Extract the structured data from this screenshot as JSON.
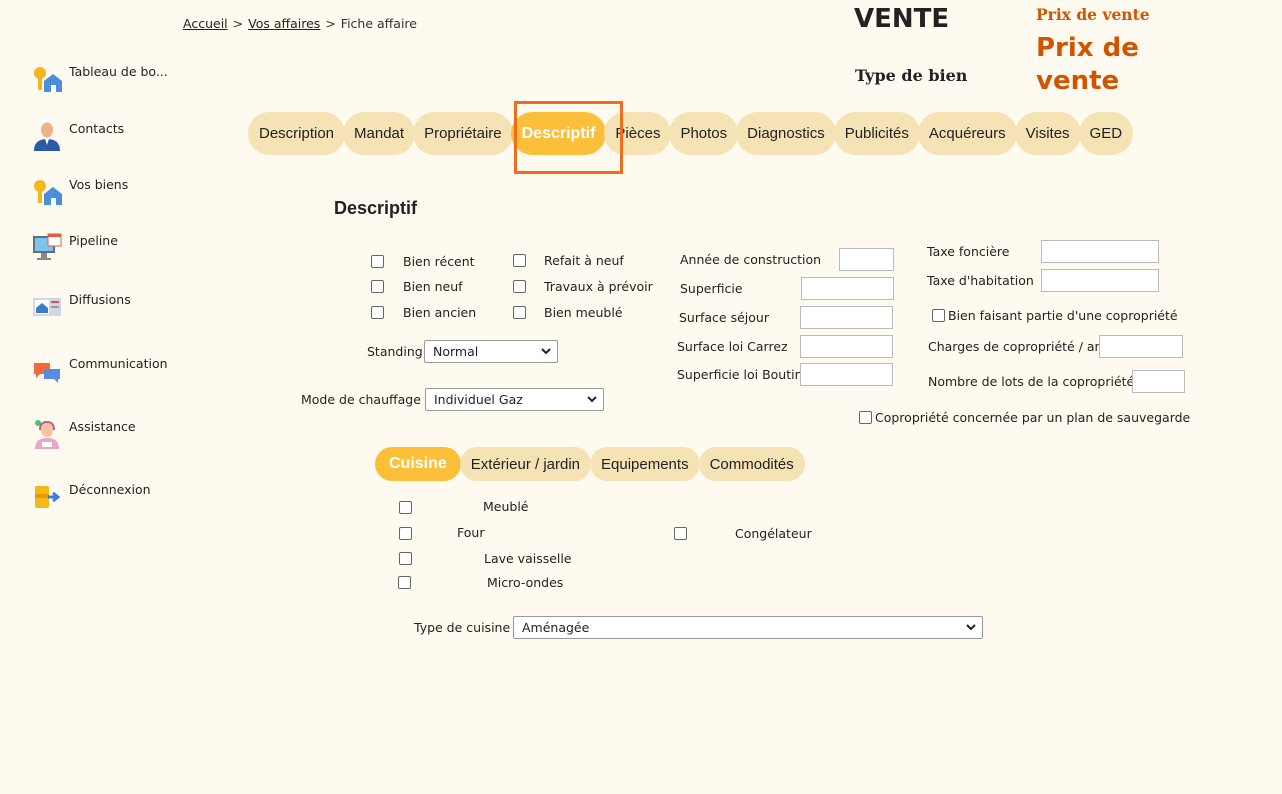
{
  "sidebar": {
    "items": [
      {
        "label": "Tableau de bo..."
      },
      {
        "label": "Contacts"
      },
      {
        "label": "Vos biens"
      },
      {
        "label": "Pipeline"
      },
      {
        "label": "Diffusions"
      },
      {
        "label": "Communication"
      },
      {
        "label": "Assistance"
      },
      {
        "label": "Déconnexion"
      }
    ]
  },
  "breadcrumb": {
    "home": "Accueil",
    "sep": ">",
    "affaires": "Vos affaires",
    "current": "Fiche affaire"
  },
  "header": {
    "transaction": "VENTE",
    "type_bien": "Type de bien",
    "prix_label": "Prix de vente",
    "prix_value": "Prix de vente"
  },
  "tabs": [
    {
      "label": "Description"
    },
    {
      "label": "Mandat"
    },
    {
      "label": "Propriétaire"
    },
    {
      "label": "Descriptif"
    },
    {
      "label": "Pièces"
    },
    {
      "label": "Photos"
    },
    {
      "label": "Diagnostics"
    },
    {
      "label": "Publicités"
    },
    {
      "label": "Acquéreurs"
    },
    {
      "label": "Visites"
    },
    {
      "label": "GED"
    }
  ],
  "section_title": "Descriptif",
  "checks": {
    "bien_recent": "Bien récent",
    "bien_neuf": "Bien neuf",
    "bien_ancien": "Bien ancien",
    "refait_neuf": "Refait à neuf",
    "travaux": "Travaux à prévoir",
    "meuble": "Bien meublé"
  },
  "standing": {
    "label": "Standing",
    "value": "Normal"
  },
  "chauffage": {
    "label": "Mode de chauffage",
    "value": "Individuel Gaz"
  },
  "fields": {
    "annee": "Année de construction",
    "superficie": "Superficie",
    "surface_sejour": "Surface séjour",
    "loi_carrez": "Surface loi Carrez",
    "loi_boutin": "Superficie loi Boutin",
    "taxe_fonciere": "Taxe foncière",
    "taxe_habitation": "Taxe d'habitation",
    "copro_check": "Bien faisant partie d'une copropriété",
    "charges_copro": "Charges de copropriété / an",
    "lots_copro": "Nombre de lots de la copropriété",
    "plan_sauvegarde": "Copropriété concernée par un plan de sauvegarde"
  },
  "subtabs": [
    {
      "label": "Cuisine"
    },
    {
      "label": "Extérieur / jardin"
    },
    {
      "label": "Equipements"
    },
    {
      "label": "Commodités"
    }
  ],
  "cuisine": {
    "meuble": "Meublé",
    "four": "Four",
    "congelateur": "Congélateur",
    "lave_vaisselle": "Lave vaisselle",
    "micro_ondes": "Micro-ondes",
    "type_label": "Type de cuisine",
    "type_value": "Aménagée"
  }
}
